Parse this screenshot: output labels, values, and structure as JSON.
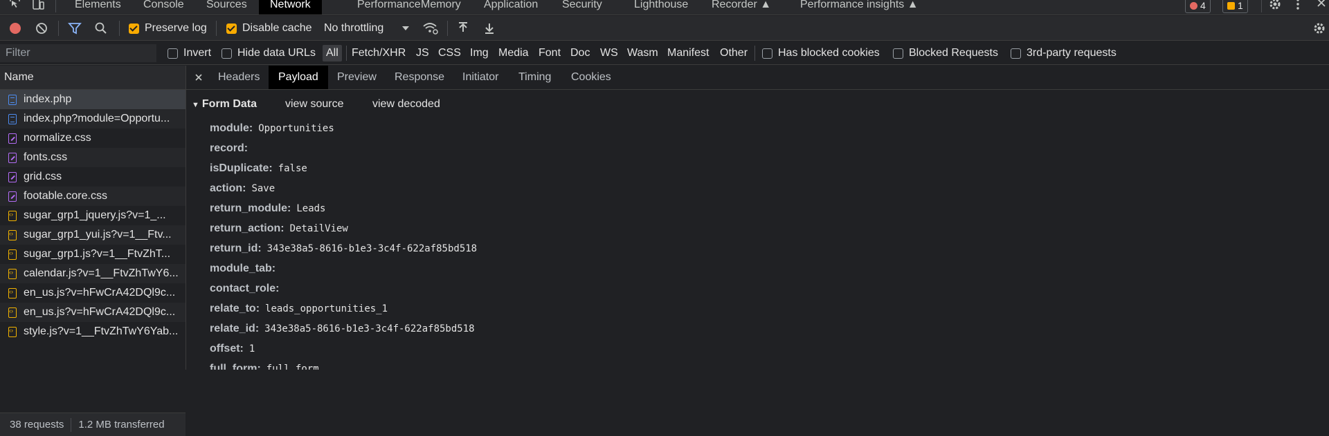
{
  "devtools_tabs": [
    "Elements",
    "Console",
    "Sources",
    "Network",
    "Performance",
    "Memory",
    "Application",
    "Security",
    "Lighthouse",
    "Recorder",
    "Performance insights"
  ],
  "active_tab": "Network",
  "badges": {
    "errors": "4",
    "warnings": "1"
  },
  "toolbar": {
    "preserve_log": "Preserve log",
    "disable_cache": "Disable cache",
    "throttling": "No throttling"
  },
  "filter": {
    "placeholder": "Filter",
    "invert": "Invert",
    "hide_data_urls": "Hide data URLs",
    "types": [
      "All",
      "Fetch/XHR",
      "JS",
      "CSS",
      "Img",
      "Media",
      "Font",
      "Doc",
      "WS",
      "Wasm",
      "Manifest",
      "Other"
    ],
    "has_blocked_cookies": "Has blocked cookies",
    "blocked_requests": "Blocked Requests",
    "third_party": "3rd-party requests"
  },
  "requests_header": "Name",
  "requests": [
    {
      "name": "index.php",
      "kind": "doc"
    },
    {
      "name": "index.php?module=Opportu...",
      "kind": "doc"
    },
    {
      "name": "normalize.css",
      "kind": "css"
    },
    {
      "name": "fonts.css",
      "kind": "css"
    },
    {
      "name": "grid.css",
      "kind": "css"
    },
    {
      "name": "footable.core.css",
      "kind": "css"
    },
    {
      "name": "sugar_grp1_jquery.js?v=1_...",
      "kind": "js"
    },
    {
      "name": "sugar_grp1_yui.js?v=1__Ftv...",
      "kind": "js"
    },
    {
      "name": "sugar_grp1.js?v=1__FtvZhT...",
      "kind": "js"
    },
    {
      "name": "calendar.js?v=1__FtvZhTwY6...",
      "kind": "js"
    },
    {
      "name": "en_us.js?v=hFwCrA42DQl9c...",
      "kind": "js"
    },
    {
      "name": "en_us.js?v=hFwCrA42DQl9c...",
      "kind": "js"
    },
    {
      "name": "style.js?v=1__FtvZhTwY6Yab...",
      "kind": "js"
    }
  ],
  "status": {
    "requests": "38 requests",
    "transferred": "1.2 MB transferred"
  },
  "detail_tabs": [
    "Headers",
    "Payload",
    "Preview",
    "Response",
    "Initiator",
    "Timing",
    "Cookies"
  ],
  "active_detail_tab": "Payload",
  "form_data": {
    "title": "Form Data",
    "view_source": "view source",
    "view_decoded": "view decoded",
    "fields": [
      {
        "key": "module:",
        "value": "Opportunities"
      },
      {
        "key": "record:",
        "value": ""
      },
      {
        "key": "isDuplicate:",
        "value": "false"
      },
      {
        "key": "action:",
        "value": "Save"
      },
      {
        "key": "return_module:",
        "value": "Leads"
      },
      {
        "key": "return_action:",
        "value": "DetailView"
      },
      {
        "key": "return_id:",
        "value": "343e38a5-8616-b1e3-3c4f-622af85bd518"
      },
      {
        "key": "module_tab:",
        "value": ""
      },
      {
        "key": "contact_role:",
        "value": ""
      },
      {
        "key": "relate_to:",
        "value": "leads_opportunities_1"
      },
      {
        "key": "relate_id:",
        "value": "343e38a5-8616-b1e3-3c4f-622af85bd518"
      },
      {
        "key": "offset:",
        "value": "1"
      },
      {
        "key": "full_form:",
        "value": "full_form"
      }
    ]
  },
  "colors": {
    "accent_checkbox": "#f9ab00",
    "record_red": "#e46962",
    "filter_blue": "#8ab4f8"
  }
}
